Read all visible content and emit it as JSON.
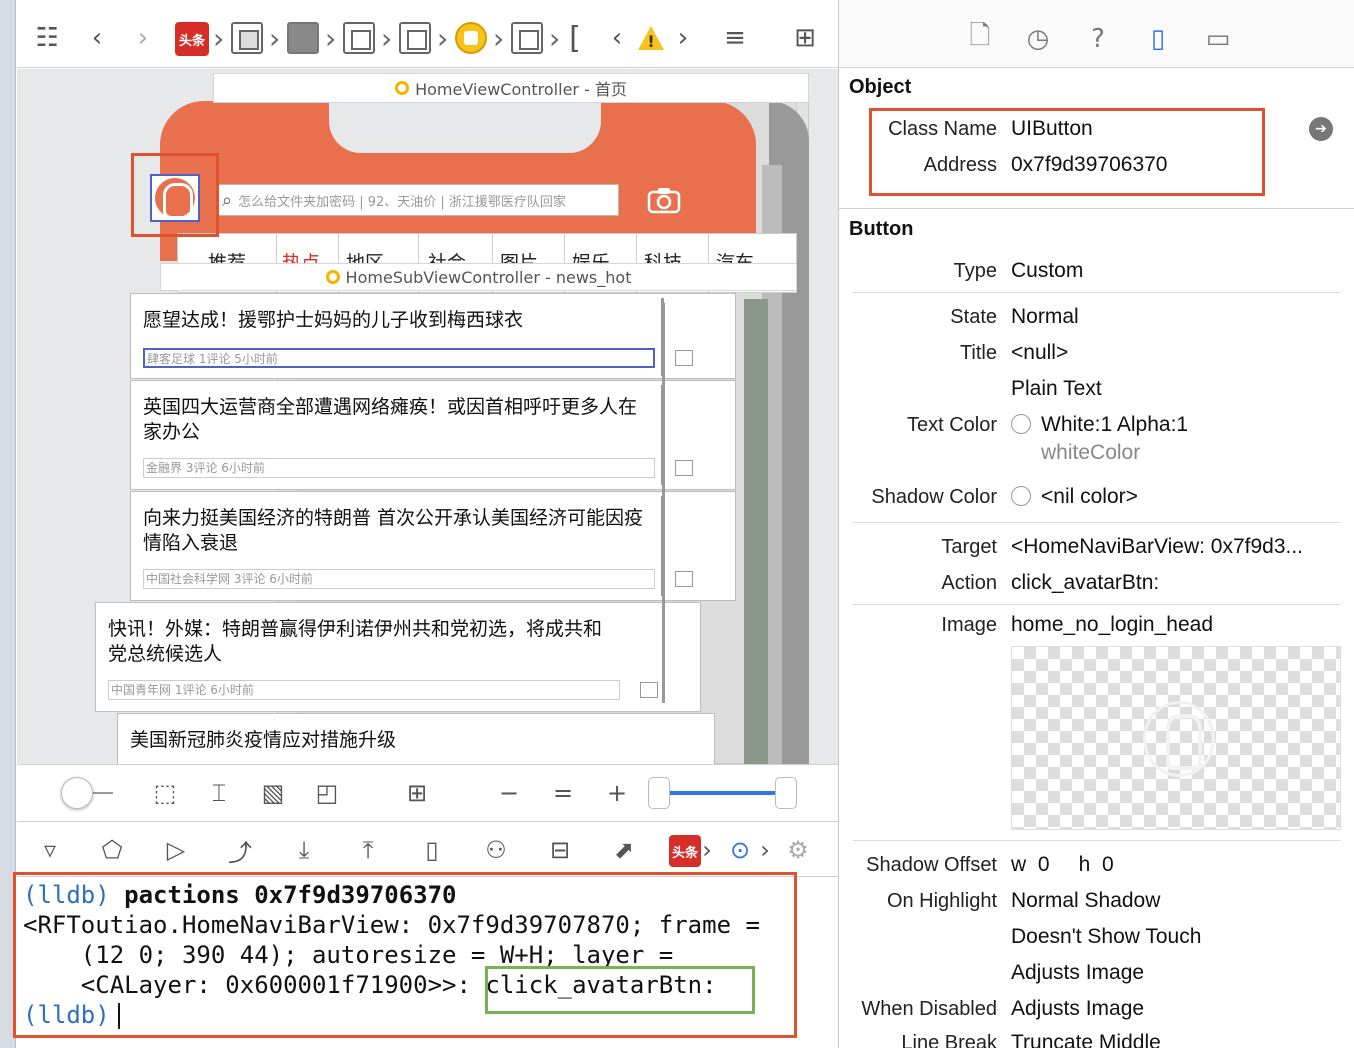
{
  "toolbar": {
    "app_badge": "头条",
    "warning_symbol": "!"
  },
  "canvas": {
    "vc_label": "HomeViewController - 首页",
    "search_placeholder": "怎么给文件夹加密码 | 92、天油价 | 浙江援鄂医疗队回家",
    "tabs": [
      "推荐",
      "热点",
      "地区",
      "社会",
      "图片",
      "娱乐",
      "科技",
      "汽车"
    ],
    "subvc_label": "HomeSubViewController - news_hot",
    "news": [
      {
        "title": "愿望达成！援鄂护士妈妈的儿子收到梅西球衣",
        "meta": "肆客足球 1评论 5小时前"
      },
      {
        "title": "英国四大运营商全部遭遇网络瘫痪！或因首相呼吁更多人在\n家办公",
        "meta": "金融界 3评论 6小时前"
      },
      {
        "title": "向来力挺美国经济的特朗普 首次公开承认美国经济可能因疫\n情陷入衰退",
        "meta": "中国社会科学网 3评论 6小时前"
      },
      {
        "title": "快讯！外媒：特朗普赢得伊利诺伊州共和党初选，将成共和\n党总统候选人",
        "meta": "中国青年网 1评论 6小时前"
      },
      {
        "title": "美国新冠肺炎疫情应对措施升级",
        "meta": ""
      }
    ]
  },
  "console": {
    "line1_prompt": "(lldb)",
    "line1_cmd": " pactions 0x7f9d39706370",
    "line2": "<RFToutiao.HomeNaviBarView: 0x7f9d39707870; frame =",
    "line3": "    (12 0; 390 44); autoresize = W+H; layer =",
    "line4_a": "    <CALayer: 0x600001f71900>>: ",
    "line4_b": "click_avatarBtn:",
    "line5_prompt": "(lldb)"
  },
  "inspector": {
    "object_title": "Object",
    "class_name_label": "Class Name",
    "class_name": "UIButton",
    "address_label": "Address",
    "address": "0x7f9d39706370",
    "button_title": "Button",
    "type_label": "Type",
    "type": "Custom",
    "state_label": "State",
    "state": "Normal",
    "title_label": "Title",
    "title": "<null>",
    "title_kind": "Plain Text",
    "text_color_label": "Text Color",
    "text_color": "White:1 Alpha:1",
    "text_color_name": "whiteColor",
    "shadow_color_label": "Shadow Color",
    "shadow_color": "<nil color>",
    "target_label": "Target",
    "target": "<HomeNaviBarView: 0x7f9d3...",
    "action_label": "Action",
    "action": "click_avatarBtn:",
    "image_label": "Image",
    "image": "home_no_login_head",
    "shadow_offset_label": "Shadow Offset",
    "shadow_offset": "w  0     h  0",
    "on_highlight_label": "On Highlight",
    "on_highlight_1": "Normal Shadow",
    "on_highlight_2": "Doesn't Show Touch",
    "on_highlight_3": "Adjusts Image",
    "when_disabled_label": "When Disabled",
    "when_disabled": "Adjusts Image",
    "line_break_label": "Line Break",
    "line_break": "Truncate Middle"
  }
}
